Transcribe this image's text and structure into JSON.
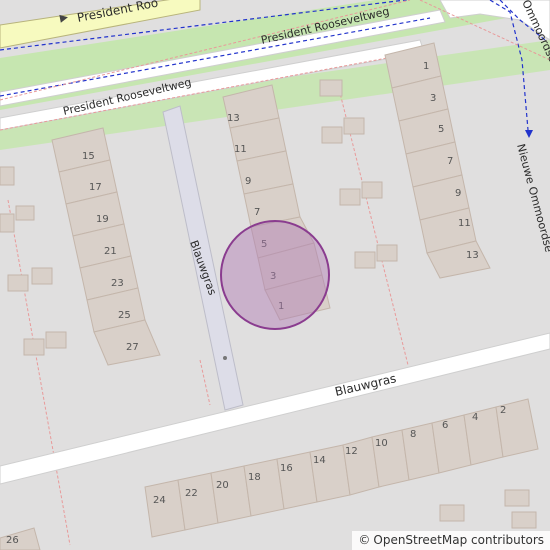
{
  "map": {
    "streets": {
      "president_roosevelt_top": "President Roo",
      "president_roosevelt_mid": "President Rooseveltweg",
      "president_roosevelt_low": "President Rooseveltweg",
      "blauwgras_path": "Blauwgras",
      "blauwgras_street": "Blauwgras",
      "ommoord_top": "Ommoordse",
      "nieuwe_ommoord": "Nieuwe Ommoordse"
    },
    "house_numbers": {
      "col_a": [
        "15",
        "17",
        "19",
        "21",
        "23",
        "25",
        "27"
      ],
      "col_b": [
        "13",
        "11",
        "9",
        "7",
        "5",
        "3",
        "1"
      ],
      "col_c": [
        "1",
        "3",
        "5",
        "7",
        "9",
        "11",
        "13"
      ],
      "row_south": [
        "24",
        "22",
        "20",
        "18",
        "16",
        "14",
        "12",
        "10",
        "8",
        "6",
        "4",
        "2"
      ],
      "corner": "26"
    },
    "marker": {
      "fill": "#b07ab4",
      "stroke": "#8a3c8f"
    },
    "colors": {
      "background": "#e0dfdf",
      "building": "#d9d0c9",
      "building_stroke": "#c4b6ab",
      "road": "#ffffff",
      "main_road": "#f7fabf",
      "grass": "#c6e6b0",
      "path": "#dddde8",
      "bus_route": "#2233cc",
      "parcel_line": "#e89a9a"
    }
  },
  "attribution": {
    "symbol": "©",
    "text": "OpenStreetMap contributors"
  }
}
